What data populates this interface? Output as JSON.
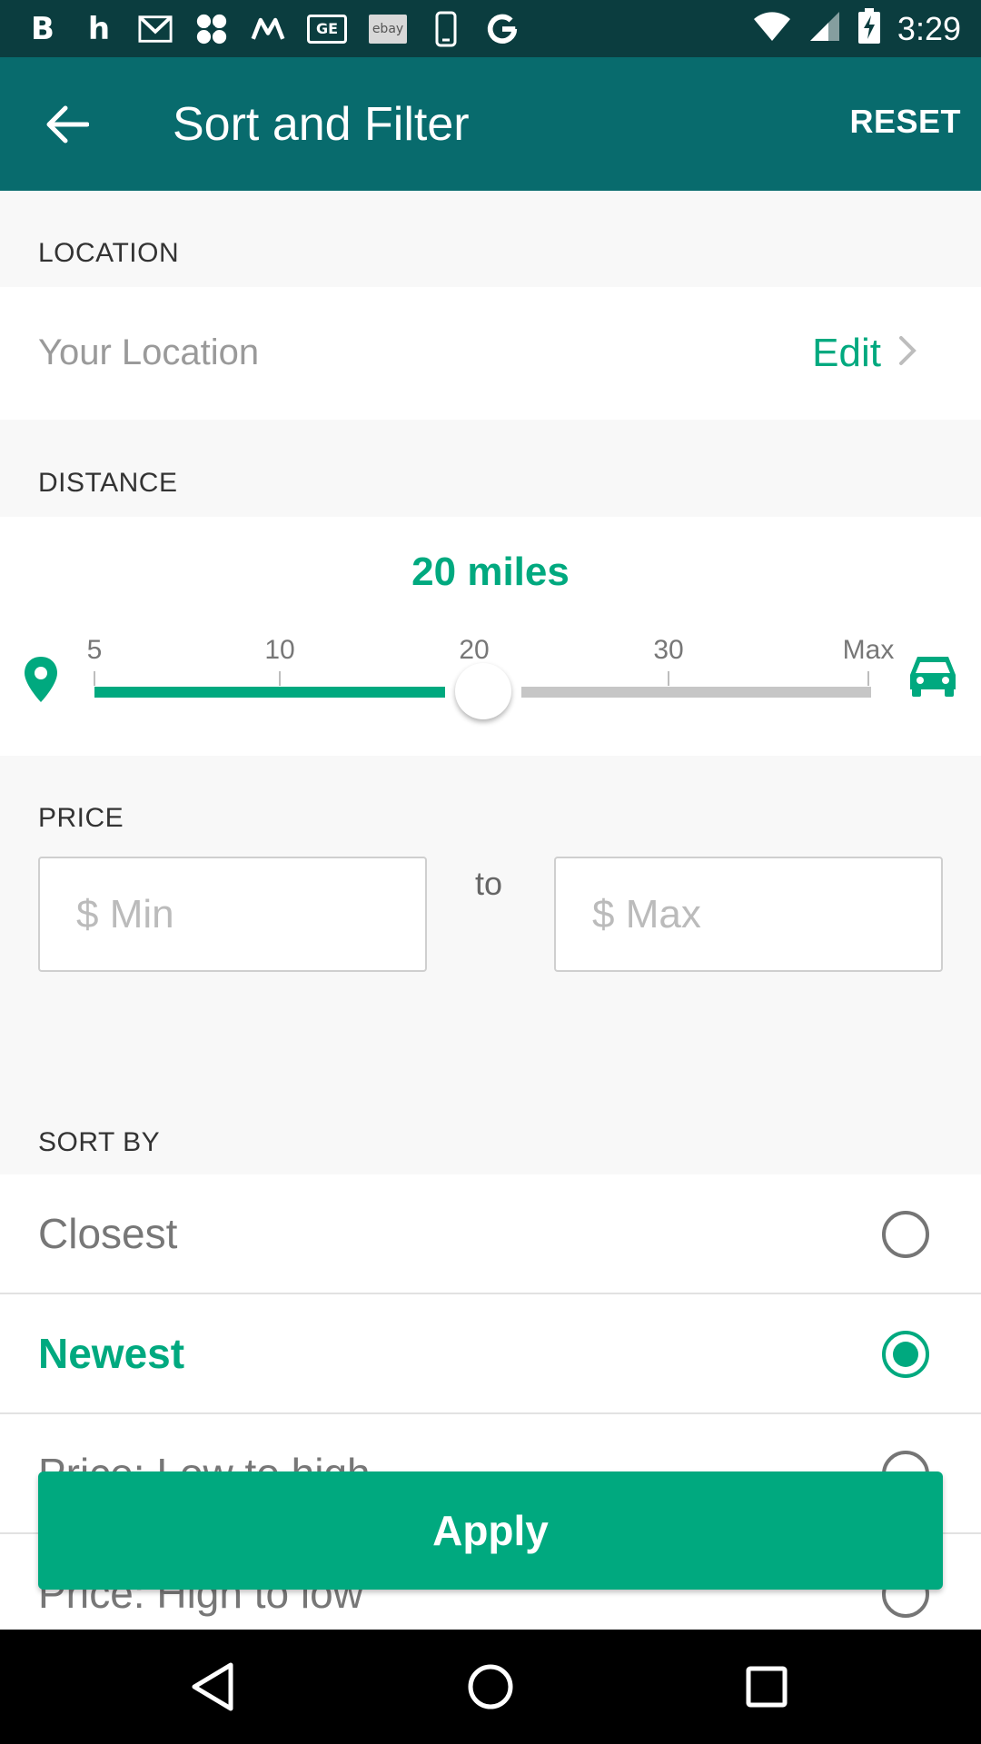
{
  "status_bar": {
    "time": "3:29",
    "icons": [
      "b-app-icon",
      "houzz-icon",
      "gmail-icon",
      "apps-icon",
      "motorola-icon",
      "ge-icon",
      "ebay-icon",
      "phone-icon",
      "google-icon"
    ],
    "ebay_text": "ebay",
    "ge_text": "GE"
  },
  "app_bar": {
    "title": "Sort and Filter",
    "reset_label": "RESET"
  },
  "location": {
    "header": "LOCATION",
    "label": "Your Location",
    "edit_label": "Edit"
  },
  "distance": {
    "header": "DISTANCE",
    "value_label": "20 miles",
    "ticks": [
      "5",
      "10",
      "20",
      "30",
      "Max"
    ],
    "selected_index": 2
  },
  "price": {
    "header": "PRICE",
    "min_placeholder": "$ Min",
    "max_placeholder": "$ Max",
    "to_label": "to"
  },
  "sort": {
    "header": "SORT BY",
    "options": [
      {
        "label": "Closest",
        "selected": false
      },
      {
        "label": "Newest",
        "selected": true
      },
      {
        "label": "Price: Low to high",
        "selected": false
      },
      {
        "label": "Price: High to low",
        "selected": false
      }
    ]
  },
  "apply_label": "Apply",
  "colors": {
    "accent": "#00a97f",
    "app_bar": "#086b6d",
    "status_bar": "#0b3d3f"
  }
}
